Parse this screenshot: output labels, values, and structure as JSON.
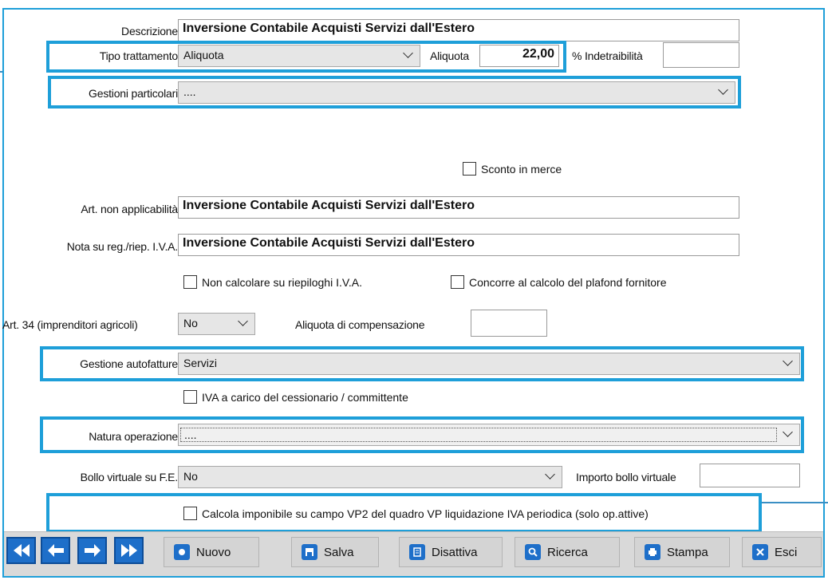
{
  "form": {
    "descrizione": {
      "label": "Descrizione",
      "value": "Inversione Contabile Acquisti Servizi dall'Estero"
    },
    "tipo_trattamento": {
      "label": "Tipo trattamento",
      "value": "Aliquota"
    },
    "aliquota": {
      "label": "Aliquota",
      "value": "22,00"
    },
    "indetraibilita": {
      "label": "% Indetraibilità",
      "value": ""
    },
    "gestioni_particolari": {
      "label": "Gestioni particolari",
      "value": "...."
    },
    "sconto_merce": {
      "label": "Sconto in merce",
      "checked": false
    },
    "art_non_applicabilita": {
      "label": "Art. non applicabilità",
      "value": "Inversione Contabile Acquisti Servizi dall'Estero"
    },
    "nota_reg": {
      "label": "Nota su reg./riep. I.V.A.",
      "value": "Inversione Contabile Acquisti Servizi dall'Estero"
    },
    "non_calcolare": {
      "label": "Non calcolare su riepiloghi I.V.A.",
      "checked": false
    },
    "concorre_plafond": {
      "label": "Concorre al calcolo del plafond fornitore",
      "checked": false
    },
    "art34": {
      "label": "Art. 34 (imprenditori agricoli)",
      "value": "No"
    },
    "aliquota_compensazione": {
      "label": "Aliquota di compensazione",
      "value": ""
    },
    "gestione_autofatture": {
      "label": "Gestione autofatture",
      "value": "Servizi"
    },
    "iva_cessionario": {
      "label": "IVA a carico del cessionario / committente",
      "checked": false
    },
    "natura_operazione": {
      "label": "Natura operazione",
      "value": "...."
    },
    "bollo_virtuale": {
      "label": "Bollo virtuale su F.E.",
      "value": "No"
    },
    "importo_bollo": {
      "label": "Importo bollo virtuale",
      "value": ""
    },
    "calcola_vp2": {
      "label": "Calcola imponibile su campo VP2 del quadro VP liquidazione IVA periodica (solo op.attive)",
      "checked": false
    }
  },
  "toolbar": {
    "nuovo": "Nuovo",
    "salva": "Salva",
    "disattiva": "Disattiva",
    "ricerca": "Ricerca",
    "stampa": "Stampa",
    "esci": "Esci"
  },
  "colors": {
    "highlight": "#1e9fd9",
    "nav_button": "#1e6fc9",
    "toolbar_bg": "#d9d9d9"
  }
}
